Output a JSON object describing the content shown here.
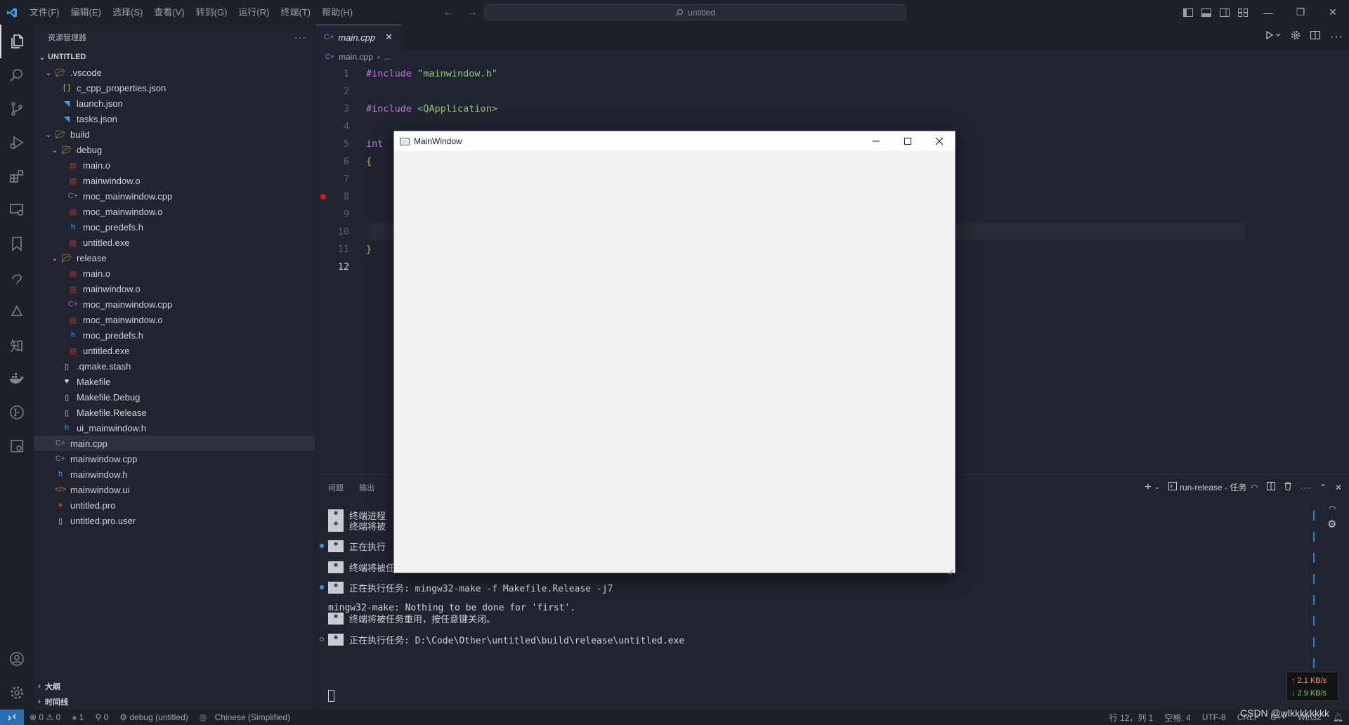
{
  "titlebar": {
    "menu": [
      "文件(F)",
      "编辑(E)",
      "选择(S)",
      "查看(V)",
      "转到(G)",
      "运行(R)",
      "终端(T)",
      "帮助(H)"
    ],
    "search_text": "untitled"
  },
  "sidebar": {
    "header": "资源管理器",
    "section": "UNTITLED",
    "tree": [
      {
        "label": ".vscode",
        "depth": 1,
        "kind": "folder-open",
        "icon": "vscode-folder-icon"
      },
      {
        "label": "c_cpp_properties.json",
        "depth": 2,
        "kind": "json",
        "icon": "json-icon"
      },
      {
        "label": "launch.json",
        "depth": 2,
        "kind": "vscode",
        "icon": "vscode-file-icon"
      },
      {
        "label": "tasks.json",
        "depth": 2,
        "kind": "vscode",
        "icon": "vscode-file-icon"
      },
      {
        "label": "build",
        "depth": 1,
        "kind": "folder-open",
        "icon": "folder-icon"
      },
      {
        "label": "debug",
        "depth": 2,
        "kind": "folder-open",
        "icon": "folder-icon"
      },
      {
        "label": "main.o",
        "depth": 3,
        "kind": "obj",
        "icon": "binary-file-icon"
      },
      {
        "label": "mainwindow.o",
        "depth": 3,
        "kind": "obj",
        "icon": "binary-file-icon"
      },
      {
        "label": "moc_mainwindow.cpp",
        "depth": 3,
        "kind": "cpp",
        "icon": "cpp-file-icon"
      },
      {
        "label": "moc_mainwindow.o",
        "depth": 3,
        "kind": "obj",
        "icon": "binary-file-icon"
      },
      {
        "label": "moc_predefs.h",
        "depth": 3,
        "kind": "h",
        "icon": "header-file-icon"
      },
      {
        "label": "untitled.exe",
        "depth": 3,
        "kind": "obj",
        "icon": "binary-file-icon"
      },
      {
        "label": "release",
        "depth": 2,
        "kind": "folder-open",
        "icon": "folder-icon"
      },
      {
        "label": "main.o",
        "depth": 3,
        "kind": "obj",
        "icon": "binary-file-icon"
      },
      {
        "label": "mainwindow.o",
        "depth": 3,
        "kind": "obj",
        "icon": "binary-file-icon"
      },
      {
        "label": "moc_mainwindow.cpp",
        "depth": 3,
        "kind": "cpp",
        "icon": "cpp-file-icon"
      },
      {
        "label": "moc_mainwindow.o",
        "depth": 3,
        "kind": "obj",
        "icon": "binary-file-icon"
      },
      {
        "label": "moc_predefs.h",
        "depth": 3,
        "kind": "h",
        "icon": "header-file-icon"
      },
      {
        "label": "untitled.exe",
        "depth": 3,
        "kind": "obj",
        "icon": "binary-file-icon"
      },
      {
        "label": ".qmake.stash",
        "depth": 2,
        "kind": "file",
        "icon": "file-icon"
      },
      {
        "label": "Makefile",
        "depth": 2,
        "kind": "make",
        "icon": "makefile-icon"
      },
      {
        "label": "Makefile.Debug",
        "depth": 2,
        "kind": "file",
        "icon": "file-icon"
      },
      {
        "label": "Makefile.Release",
        "depth": 2,
        "kind": "file",
        "icon": "file-icon"
      },
      {
        "label": "ui_mainwindow.h",
        "depth": 2,
        "kind": "h",
        "icon": "header-file-icon"
      },
      {
        "label": "main.cpp",
        "depth": 1,
        "kind": "cpp",
        "icon": "cpp-file-icon",
        "selected": true
      },
      {
        "label": "mainwindow.cpp",
        "depth": 1,
        "kind": "cpp",
        "icon": "cpp-file-icon"
      },
      {
        "label": "mainwindow.h",
        "depth": 1,
        "kind": "h",
        "icon": "header-file-icon"
      },
      {
        "label": "mainwindow.ui",
        "depth": 1,
        "kind": "xml",
        "icon": "xml-file-icon"
      },
      {
        "label": "untitled.pro",
        "depth": 1,
        "kind": "pro",
        "icon": "qt-pro-icon"
      },
      {
        "label": "untitled.pro.user",
        "depth": 1,
        "kind": "file",
        "icon": "file-icon"
      }
    ],
    "outline": "大纲",
    "timeline": "时间线"
  },
  "editor": {
    "tab_label": "main.cpp",
    "breadcrumb_file": "main.cpp",
    "breadcrumb_rest": "...",
    "lines": [
      {
        "n": "1",
        "parts": [
          {
            "t": "#include ",
            "c": "kw"
          },
          {
            "t": "\"mainwindow.h\"",
            "c": "str"
          }
        ]
      },
      {
        "n": "2",
        "parts": []
      },
      {
        "n": "3",
        "parts": [
          {
            "t": "#include ",
            "c": "kw"
          },
          {
            "t": "<QApplication>",
            "c": "str"
          }
        ]
      },
      {
        "n": "4",
        "parts": []
      },
      {
        "n": "5",
        "parts": [
          {
            "t": "int",
            "c": "kw"
          }
        ]
      },
      {
        "n": "6",
        "parts": [
          {
            "t": "{",
            "c": "punct"
          }
        ]
      },
      {
        "n": "7",
        "parts": []
      },
      {
        "n": "8",
        "parts": []
      },
      {
        "n": "9",
        "parts": []
      },
      {
        "n": "10",
        "parts": []
      },
      {
        "n": "11",
        "parts": [
          {
            "t": "}",
            "c": "punct"
          }
        ]
      },
      {
        "n": "12",
        "parts": []
      }
    ],
    "current_line": "12",
    "breakpoint_line": "8"
  },
  "panel": {
    "tabs": [
      "问题",
      "输出"
    ],
    "terminal_name": "run-release - 任务",
    "terminal_lines": [
      {
        "star": true,
        "text": "终端进程",
        "dot": ""
      },
      {
        "star": true,
        "text": "终端将被",
        "dot": ""
      },
      {
        "star": true,
        "text": "正在执行",
        "dot": "blue"
      },
      {
        "star": true,
        "text": "终端将被任务重用，按任意键关闭。",
        "dot": ""
      },
      {
        "star": true,
        "text": "正在执行任务: mingw32-make -f Makefile.Release -j7",
        "dot": "blue"
      },
      {
        "star": false,
        "text": "mingw32-make: Nothing to be done for 'first'.",
        "dot": ""
      },
      {
        "star": true,
        "text": "终端将被任务重用，按任意键关闭。",
        "dot": ""
      },
      {
        "star": true,
        "text": "正在执行任务: D:\\Code\\Other\\untitled\\build\\release\\untitled.exe",
        "dot": "grey"
      }
    ]
  },
  "statusbar": {
    "errors": "0",
    "warnings": "0",
    "git": "1",
    "ports": "0",
    "debug_config": "debug (untitled)",
    "language_pack": "Chinese (Simplified)",
    "cursor": "行 12，列 1",
    "indent": "空格: 4",
    "encoding": "UTF-8",
    "eol": "CRLF",
    "lang": "C++",
    "platform": "Win32"
  },
  "netspeed": {
    "up": "↑ 2.1 KB/s",
    "down": "↓ 2.9 KB/s"
  },
  "qt_window": {
    "title": "MainWindow"
  },
  "watermark": "CSDN @wlkkkkkkkk",
  "colors": {
    "accent": "#3c7bd6",
    "remote": "#2c6fb5",
    "breakpoint": "#e51400"
  }
}
